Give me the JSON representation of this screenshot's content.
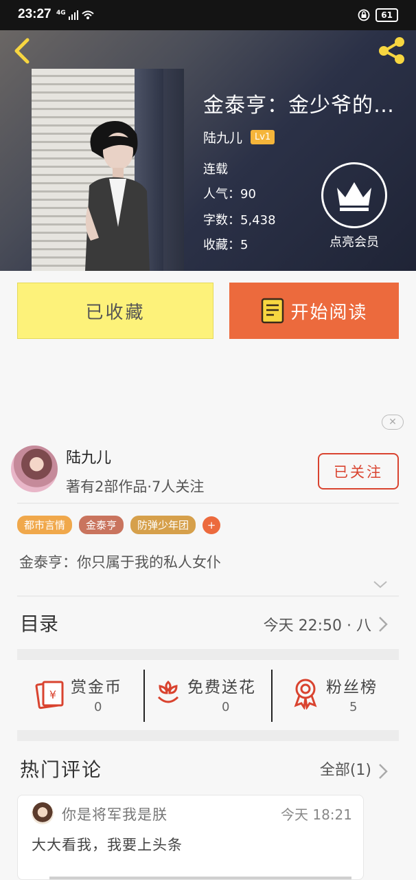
{
  "status_bar": {
    "time": "23:27",
    "network": "4G",
    "battery": "61"
  },
  "header": {
    "book_title": "金泰亨：金少爷的…",
    "author": "陆九儿",
    "level": "Lv1",
    "status": "连载",
    "popularity": "人气：90",
    "word_count": "字数：5,438",
    "favorites": "收藏：5",
    "vip_label": "点亮会员"
  },
  "actions": {
    "collected_label": "已收藏",
    "read_label": "开始阅读"
  },
  "ad_close": "✕",
  "author_card": {
    "name": "陆九儿",
    "stats": "著有2部作品·7人关注",
    "follow_label": "已关注"
  },
  "tags": [
    {
      "label": "都市言情",
      "color": "#f0a84b"
    },
    {
      "label": "金泰亨",
      "color": "#c9745e"
    },
    {
      "label": "防弹少年团",
      "color": "#d6a04b"
    }
  ],
  "tag_add": "+",
  "description": "金泰亨：你只属于我的私人女仆",
  "toc": {
    "title": "目录",
    "update": "今天 22:50 · 八"
  },
  "rewards": [
    {
      "name": "赏金币",
      "value": "0",
      "icon": "red-envelope-icon"
    },
    {
      "name": "免费送花",
      "value": "0",
      "icon": "flower-icon"
    },
    {
      "name": "粉丝榜",
      "value": "5",
      "icon": "award-ribbon-icon"
    }
  ],
  "hot_comments": {
    "title": "热门评论",
    "all_label": "全部(1)"
  },
  "comment": {
    "user": "你是将军我是朕",
    "time": "今天 18:21",
    "text": "大大看我，我要上头条"
  },
  "colors": {
    "accent_orange": "#ec6a3d",
    "collected_yellow": "#fdf27a",
    "follow_red": "#d9432f",
    "level_badge": "#f5b53a"
  }
}
